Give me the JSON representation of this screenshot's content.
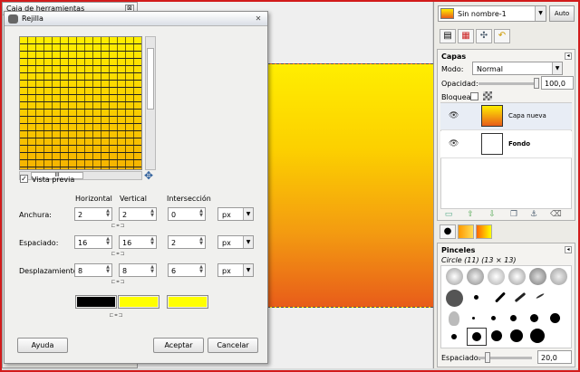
{
  "toolbox": {
    "title": "Caja de herramientas",
    "close": "⊠"
  },
  "dialog": {
    "title": "Rejilla",
    "close": "✕",
    "preview_checkbox_label": "Vista previa",
    "preview_checked": true,
    "scroll_thumb": "III",
    "columns": {
      "horizontal": "Horizontal",
      "vertical": "Vertical",
      "intersection": "Intersección"
    },
    "rows": [
      {
        "label": "Anchura:",
        "horizontal": "2",
        "vertical": "2",
        "intersection": "0",
        "unit": "px"
      },
      {
        "label": "Espaciado:",
        "horizontal": "16",
        "vertical": "16",
        "intersection": "2",
        "unit": "px"
      },
      {
        "label": "Desplazamiento:",
        "horizontal": "8",
        "vertical": "8",
        "intersection": "6",
        "unit": "px"
      }
    ],
    "colors": [
      "#000000",
      "#ffff00",
      "#ffff00"
    ],
    "help_button": "Ayuda",
    "ok_button": "Aceptar",
    "cancel_button": "Cancelar"
  },
  "right_panel": {
    "image_name": "Sin nombre-1",
    "auto_button": "Auto",
    "layers": {
      "title": "Capas",
      "mode_label": "Modo:",
      "mode_value": "Normal",
      "opacity_label": "Opacidad:",
      "opacity_value": "100,0",
      "lock_label": "Bloquear:",
      "items": [
        {
          "name": "Capa nueva",
          "bold": false
        },
        {
          "name": "Fondo",
          "bold": true
        }
      ]
    },
    "brushes": {
      "title": "Pinceles",
      "brush_info": "Circle (11) (13 × 13)",
      "spacing_label": "Espaciado:",
      "spacing_value": "20,0"
    }
  }
}
